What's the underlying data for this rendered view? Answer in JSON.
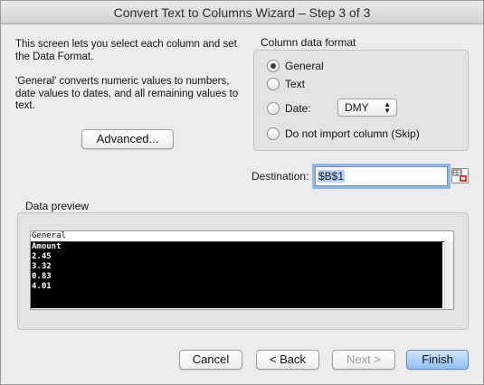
{
  "window": {
    "title": "Convert Text to Columns Wizard – Step 3 of 3"
  },
  "intro": {
    "line1": "This screen lets you select each column and set the Data Format.",
    "line2": "'General' converts numeric values to numbers, date values to dates, and all remaining values to text."
  },
  "advanced_label": "Advanced...",
  "column_format": {
    "label": "Column data format",
    "options": [
      "General",
      "Text",
      "Date:",
      "Do not import column (Skip)"
    ],
    "selected": "General",
    "date_format": "DMY"
  },
  "destination": {
    "label": "Destination:",
    "value": "$B$1"
  },
  "preview": {
    "label": "Data preview",
    "header": "General",
    "rows": [
      "Amount",
      "2.45",
      "3.32",
      "0.83",
      "4.01"
    ]
  },
  "buttons": {
    "cancel": "Cancel",
    "back": "< Back",
    "next": "Next >",
    "finish": "Finish"
  },
  "colors": {
    "accent": "#8db7ef",
    "finish_button": "#8fc0f2",
    "preview_selection": "#000000"
  },
  "icons": {
    "radio": "radio-button",
    "select_arrows": "up-down-chevron-icon",
    "collapse": "range-select-icon"
  }
}
